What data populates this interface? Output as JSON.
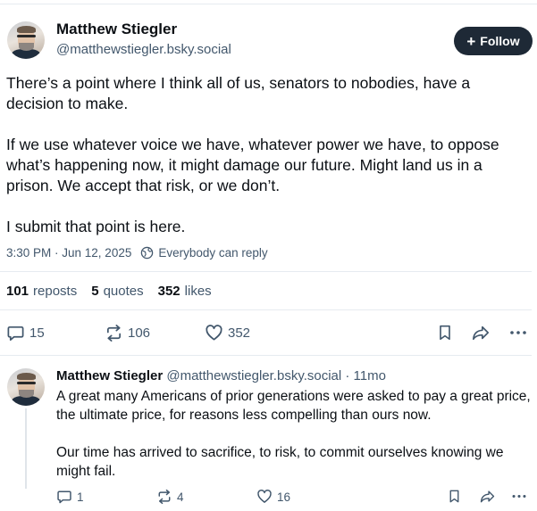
{
  "post": {
    "author_name": "Matthew Stiegler",
    "author_handle": "@matthewstiegler.bsky.social",
    "follow_label": "Follow",
    "paragraphs": [
      "There’s a point where I think all of us, senators to nobodies, have a decision to make.",
      "If we use whatever voice we have, whatever power we have, to oppose what’s happening now, it might damage our future. Might land us in a prison. We accept that risk, or we don’t.",
      "I submit that point is here."
    ],
    "timestamp": "3:30 PM · Jun 12, 2025",
    "reply_setting": "Everybody can reply",
    "stats": {
      "reposts_count": "101",
      "reposts_label": "reposts",
      "quotes_count": "5",
      "quotes_label": "quotes",
      "likes_count": "352",
      "likes_label": "likes"
    },
    "actions": {
      "replies": "15",
      "reposts": "106",
      "likes": "352"
    }
  },
  "reply": {
    "author_name": "Matthew Stiegler",
    "author_handle_time": "@matthewstiegler.bsky.social · 11mo",
    "paragraphs": [
      "A great many Americans of prior generations were asked to pay a great price, the ultimate price, for reasons less compelling than ours now.",
      "Our time has arrived to sacrifice, to risk, to commit ourselves knowing we might fail."
    ],
    "actions": {
      "replies": "1",
      "reposts": "4",
      "likes": "16"
    }
  },
  "icons": [
    "reply-icon",
    "repost-icon",
    "like-icon",
    "bookmark-icon",
    "share-icon",
    "more-icon",
    "globe-icon",
    "plus-icon"
  ],
  "colors": {
    "text": "#0b0f14",
    "secondary": "#42576c",
    "follow_button": "#1e2936",
    "divider": "#e6ebf0"
  }
}
